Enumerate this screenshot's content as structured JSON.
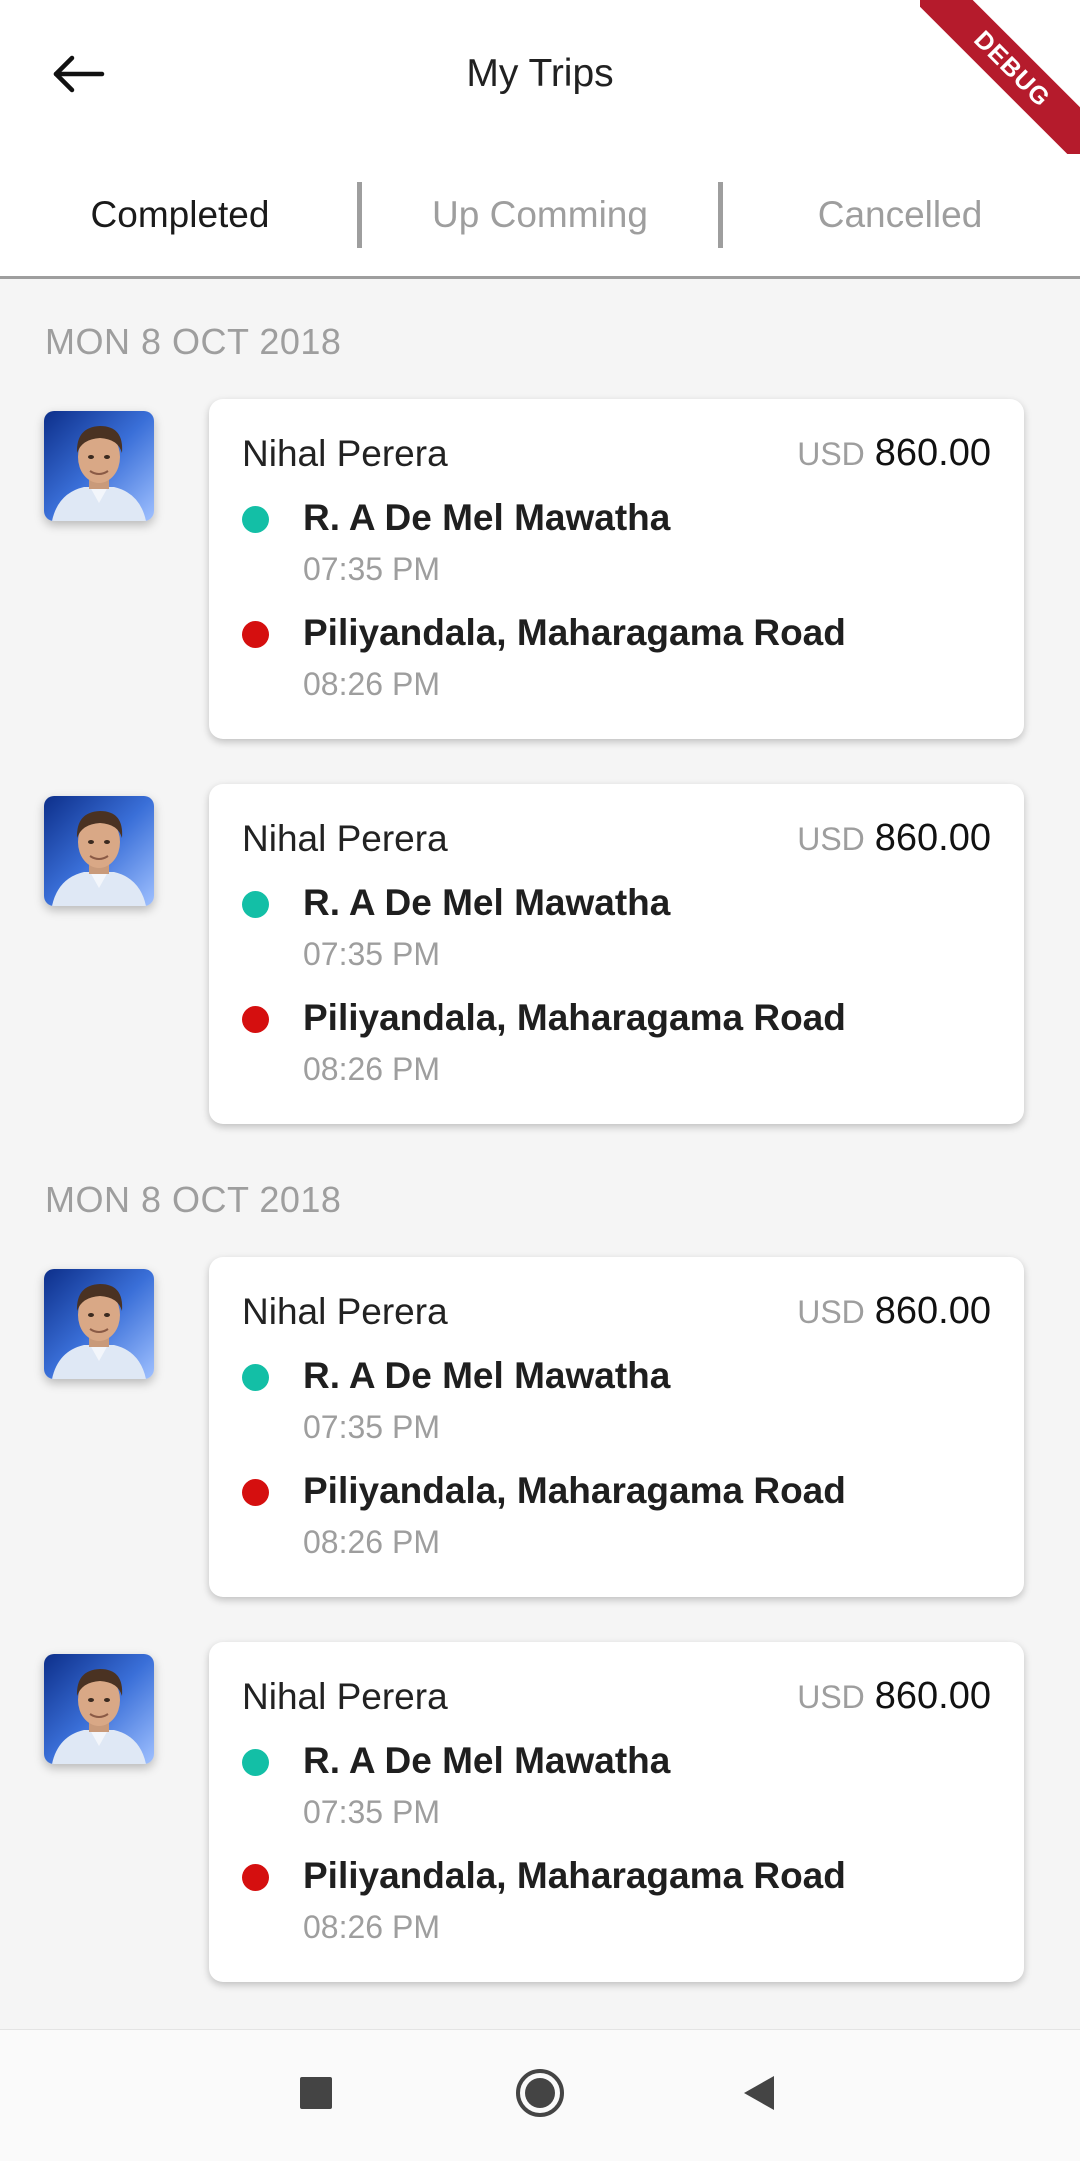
{
  "appbar": {
    "title": "My Trips",
    "back_icon": "arrow-left-icon",
    "debug_label": "DEBUG",
    "debug_color": "#b51b2c"
  },
  "tabs": [
    {
      "label": "Completed",
      "active": true
    },
    {
      "label": "Up Comming",
      "active": false
    },
    {
      "label": "Cancelled",
      "active": false
    }
  ],
  "colors": {
    "pickup_dot": "#13bfa6",
    "drop_dot": "#d50f0f",
    "muted_text": "#9e9e9e"
  },
  "groups": [
    {
      "date": "MON 8 OCT 2018",
      "trips": [
        {
          "driver": "Nihal Perera",
          "currency": "USD",
          "amount": "860.00",
          "pickup": "R. A De Mel Mawatha",
          "pickup_time": "07:35 PM",
          "drop": "Piliyandala, Maharagama Road",
          "drop_time": "08:26 PM"
        },
        {
          "driver": "Nihal Perera",
          "currency": "USD",
          "amount": "860.00",
          "pickup": "R. A De Mel Mawatha",
          "pickup_time": "07:35 PM",
          "drop": "Piliyandala, Maharagama Road",
          "drop_time": "08:26 PM"
        }
      ]
    },
    {
      "date": "MON 8 OCT 2018",
      "trips": [
        {
          "driver": "Nihal Perera",
          "currency": "USD",
          "amount": "860.00",
          "pickup": "R. A De Mel Mawatha",
          "pickup_time": "07:35 PM",
          "drop": "Piliyandala, Maharagama Road",
          "drop_time": "08:26 PM"
        },
        {
          "driver": "Nihal Perera",
          "currency": "USD",
          "amount": "860.00",
          "pickup": "R. A De Mel Mawatha",
          "pickup_time": "07:35 PM",
          "drop": "Piliyandala, Maharagama Road",
          "drop_time": "08:26 PM"
        }
      ]
    }
  ],
  "navbar": {
    "icons": [
      "square-stop-icon",
      "circle-home-icon",
      "triangle-back-icon"
    ]
  }
}
